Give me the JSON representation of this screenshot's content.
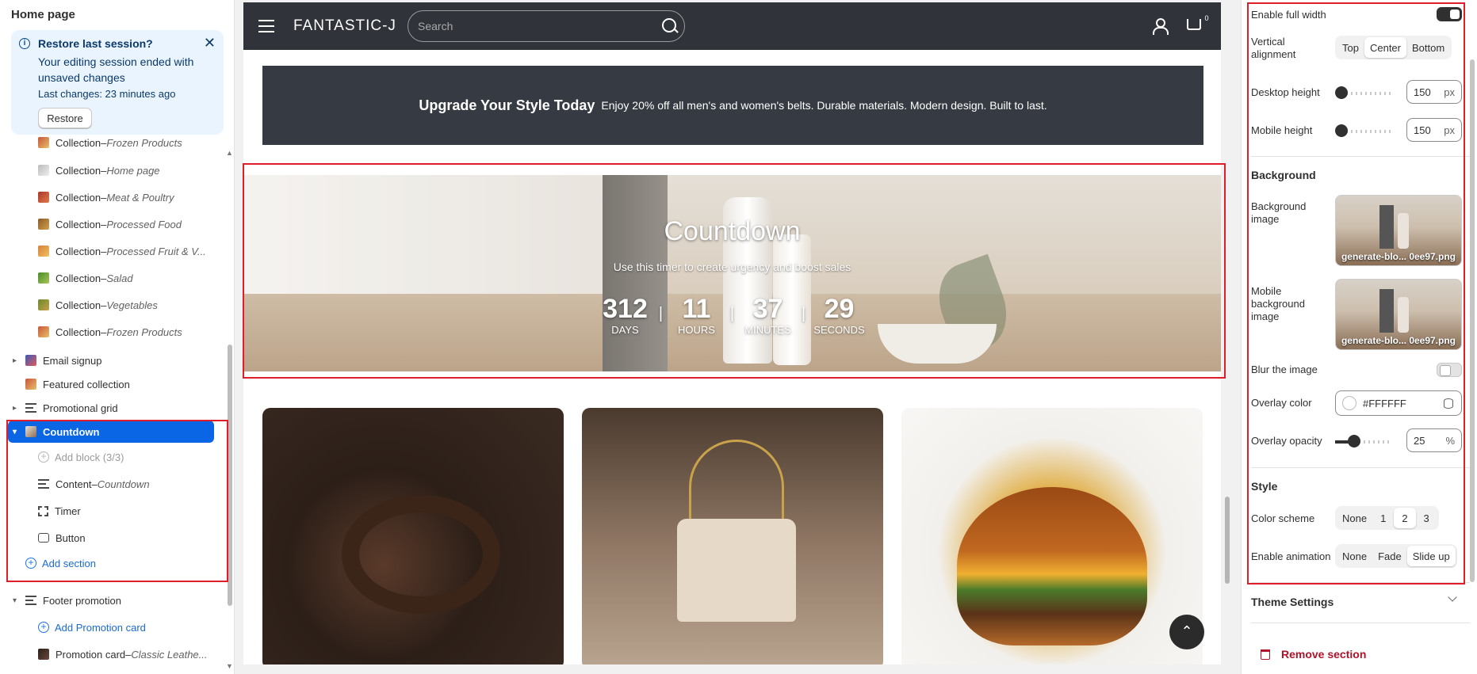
{
  "left_panel": {
    "title": "Home page",
    "banner": {
      "title": "Restore last session?",
      "message": "Your editing session ended with unsaved changes",
      "last_changes": "Last changes: 23 minutes ago",
      "restore_label": "Restore"
    },
    "tree": [
      {
        "label": "Collection",
        "sub": "Frozen Products"
      },
      {
        "label": "Collection",
        "sub": "Home page"
      },
      {
        "label": "Collection",
        "sub": "Meat & Poultry"
      },
      {
        "label": "Collection",
        "sub": "Processed Food"
      },
      {
        "label": "Collection",
        "sub": "Processed Fruit & V..."
      },
      {
        "label": "Collection",
        "sub": "Salad"
      },
      {
        "label": "Collection",
        "sub": "Vegetables"
      },
      {
        "label": "Collection",
        "sub": "Frozen Products"
      }
    ],
    "email_signup": "Email signup",
    "featured_collection": "Featured collection",
    "promotional_grid": "Promotional grid",
    "countdown": "Countdown",
    "add_block": "Add block (3/3)",
    "content_label": "Content",
    "content_sub": "Countdown",
    "timer": "Timer",
    "button": "Button",
    "add_section": "Add section",
    "footer_promotion": "Footer promotion",
    "add_promotion_card": "Add Promotion card",
    "promotion_card_label": "Promotion card",
    "promotion_card_sub": "Classic Leathe...",
    "separator": " – "
  },
  "preview": {
    "brand": "FANTASTIC-J",
    "search_placeholder": "Search",
    "cart_count": "0",
    "promo_title": "Upgrade Your Style Today",
    "promo_text": "Enjoy 20% off all men's and women's belts. Durable materials. Modern design. Built to last.",
    "countdown": {
      "title": "Countdown",
      "subtitle": "Use this timer to create urgency and boost sales",
      "units": [
        {
          "value": "312",
          "label": "DAYS"
        },
        {
          "value": "11",
          "label": "HOURS"
        },
        {
          "value": "37",
          "label": "MINUTES"
        },
        {
          "value": "29",
          "label": "SECONDS"
        }
      ],
      "separator": "|"
    },
    "back_to_top": "⌃"
  },
  "settings": {
    "enable_full_width": "Enable full width",
    "vertical_alignment": "Vertical alignment",
    "alignment_options": [
      "Top",
      "Center",
      "Bottom"
    ],
    "alignment_selected": "Center",
    "desktop_height": "Desktop height",
    "desktop_height_value": "150",
    "mobile_height": "Mobile height",
    "mobile_height_value": "150",
    "unit_px": "px",
    "background_heading": "Background",
    "background_image": "Background image",
    "mobile_background_image": "Mobile background image",
    "image_file": "generate-blo... 0ee97.png",
    "blur_image": "Blur the image",
    "overlay_color": "Overlay color",
    "overlay_color_value": "#FFFFFF",
    "overlay_opacity": "Overlay opacity",
    "overlay_opacity_value": "25",
    "unit_percent": "%",
    "style_heading": "Style",
    "color_scheme": "Color scheme",
    "color_scheme_options": [
      "None",
      "1",
      "2",
      "3"
    ],
    "color_scheme_selected": "2",
    "enable_animation": "Enable animation",
    "animation_options": [
      "None",
      "Fade",
      "Slide up"
    ],
    "animation_selected": "Slide up",
    "theme_settings": "Theme Settings",
    "remove_section": "Remove section"
  },
  "colors": {
    "accent_blue": "#0a66e4",
    "highlight_red": "#e01e2a",
    "header_dark": "#303339",
    "remove_red": "#b0122a"
  }
}
